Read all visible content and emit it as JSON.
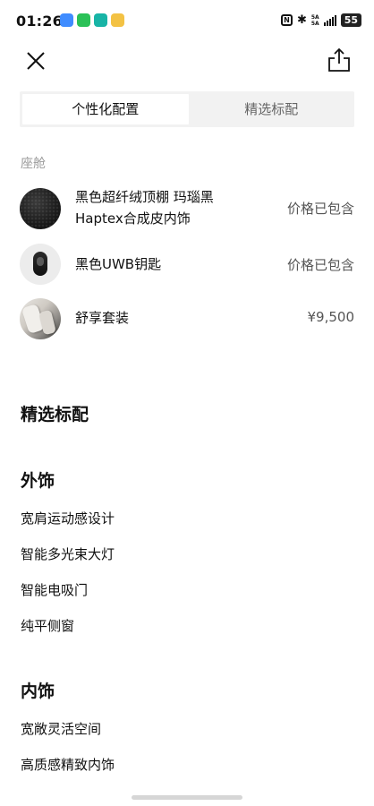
{
  "status_bar": {
    "time": "01:26",
    "network_top": "5A",
    "network_bottom": "5A",
    "battery": "55"
  },
  "nav": {
    "close_icon": "close-icon",
    "share_icon": "share-icon"
  },
  "tabs": [
    {
      "label": "个性化配置",
      "active": true
    },
    {
      "label": "精选标配",
      "active": false
    }
  ],
  "cabin": {
    "section_label": "座舱",
    "items": [
      {
        "name_line1": "黑色超纤绒顶棚 玛瑙黑",
        "name_line2": "Haptex合成皮内饰",
        "price": "价格已包含"
      },
      {
        "name": "黑色UWB钥匙",
        "price": "价格已包含"
      },
      {
        "name": "舒享套装",
        "price": "¥9,500"
      }
    ]
  },
  "standard": {
    "title": "精选标配",
    "exterior": {
      "title": "外饰",
      "items": [
        "宽肩运动感设计",
        "智能多光束大灯",
        "智能电吸门",
        "纯平侧窗"
      ]
    },
    "interior": {
      "title": "内饰",
      "items": [
        "宽敞灵活空间",
        "高质感精致内饰"
      ]
    }
  },
  "colors": {
    "tab_bg": "#f2f2f2",
    "muted_text": "#9a9a9a",
    "price_text": "#555555"
  }
}
